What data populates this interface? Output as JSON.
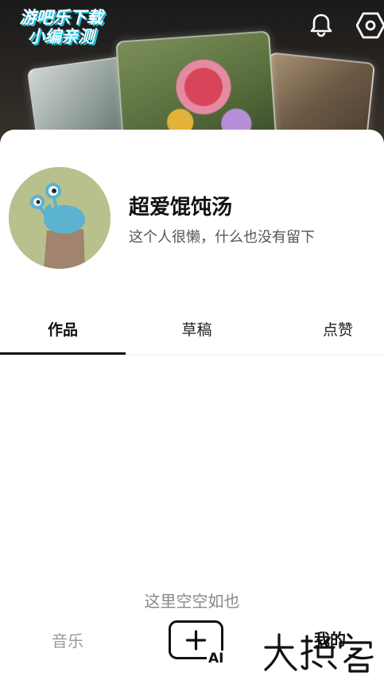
{
  "banner": {
    "logo_line1": "游吧乐下载",
    "logo_line2": "小编亲测",
    "icons": [
      "bell-icon",
      "gear-icon"
    ]
  },
  "profile": {
    "username": "超爱馄饨汤",
    "bio": "这个人很懒，什么也没有留下"
  },
  "tabs": [
    {
      "label": "作品",
      "active": true
    },
    {
      "label": "草稿",
      "active": false
    },
    {
      "label": "点赞",
      "active": false
    }
  ],
  "empty_state": "这里空空如也",
  "bottom_nav": {
    "music_label": "音乐",
    "create_icon": "add-ai-icon",
    "create_badge": "AI",
    "mine_label": "我的"
  },
  "colors": {
    "logo_accent": "#1ec8e6",
    "muted_text": "#9a9a9a",
    "avatar_bg": "#b8c08e"
  }
}
